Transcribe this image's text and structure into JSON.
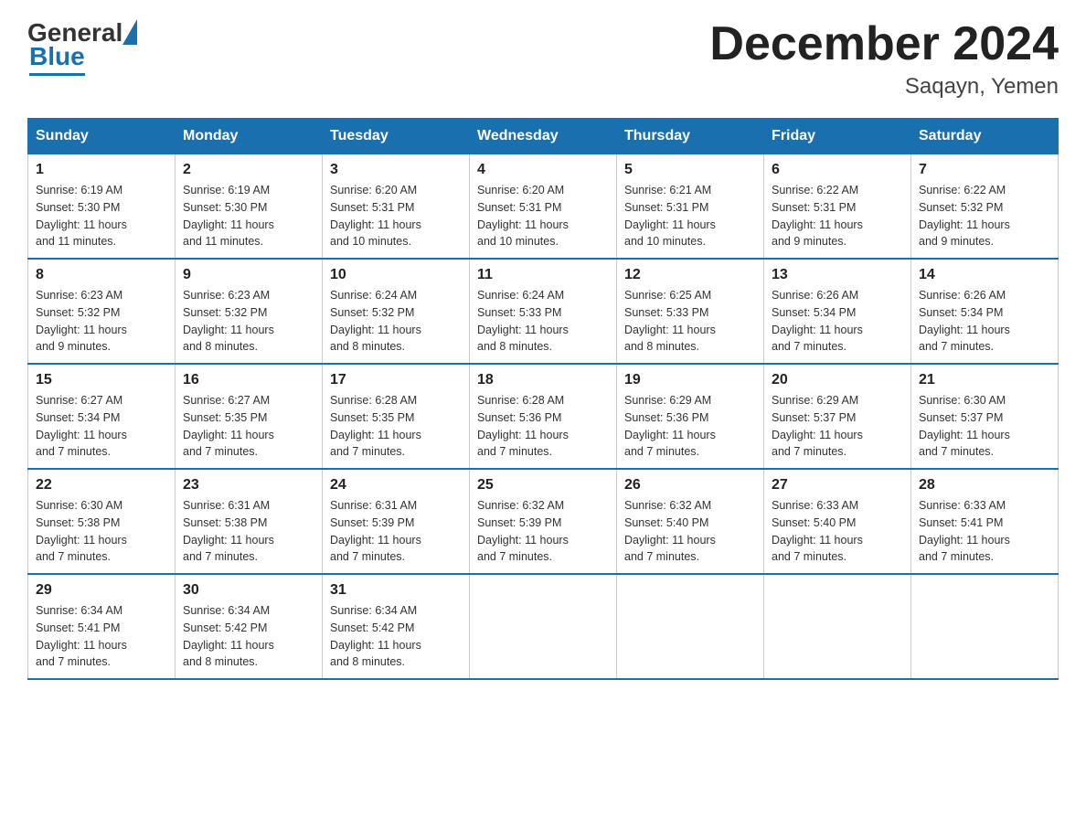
{
  "header": {
    "logo_general": "General",
    "logo_blue": "Blue",
    "title": "December 2024",
    "subtitle": "Saqayn, Yemen"
  },
  "columns": [
    "Sunday",
    "Monday",
    "Tuesday",
    "Wednesday",
    "Thursday",
    "Friday",
    "Saturday"
  ],
  "weeks": [
    [
      {
        "day": "1",
        "sunrise": "6:19 AM",
        "sunset": "5:30 PM",
        "daylight": "11 hours and 11 minutes."
      },
      {
        "day": "2",
        "sunrise": "6:19 AM",
        "sunset": "5:30 PM",
        "daylight": "11 hours and 11 minutes."
      },
      {
        "day": "3",
        "sunrise": "6:20 AM",
        "sunset": "5:31 PM",
        "daylight": "11 hours and 10 minutes."
      },
      {
        "day": "4",
        "sunrise": "6:20 AM",
        "sunset": "5:31 PM",
        "daylight": "11 hours and 10 minutes."
      },
      {
        "day": "5",
        "sunrise": "6:21 AM",
        "sunset": "5:31 PM",
        "daylight": "11 hours and 10 minutes."
      },
      {
        "day": "6",
        "sunrise": "6:22 AM",
        "sunset": "5:31 PM",
        "daylight": "11 hours and 9 minutes."
      },
      {
        "day": "7",
        "sunrise": "6:22 AM",
        "sunset": "5:32 PM",
        "daylight": "11 hours and 9 minutes."
      }
    ],
    [
      {
        "day": "8",
        "sunrise": "6:23 AM",
        "sunset": "5:32 PM",
        "daylight": "11 hours and 9 minutes."
      },
      {
        "day": "9",
        "sunrise": "6:23 AM",
        "sunset": "5:32 PM",
        "daylight": "11 hours and 8 minutes."
      },
      {
        "day": "10",
        "sunrise": "6:24 AM",
        "sunset": "5:32 PM",
        "daylight": "11 hours and 8 minutes."
      },
      {
        "day": "11",
        "sunrise": "6:24 AM",
        "sunset": "5:33 PM",
        "daylight": "11 hours and 8 minutes."
      },
      {
        "day": "12",
        "sunrise": "6:25 AM",
        "sunset": "5:33 PM",
        "daylight": "11 hours and 8 minutes."
      },
      {
        "day": "13",
        "sunrise": "6:26 AM",
        "sunset": "5:34 PM",
        "daylight": "11 hours and 7 minutes."
      },
      {
        "day": "14",
        "sunrise": "6:26 AM",
        "sunset": "5:34 PM",
        "daylight": "11 hours and 7 minutes."
      }
    ],
    [
      {
        "day": "15",
        "sunrise": "6:27 AM",
        "sunset": "5:34 PM",
        "daylight": "11 hours and 7 minutes."
      },
      {
        "day": "16",
        "sunrise": "6:27 AM",
        "sunset": "5:35 PM",
        "daylight": "11 hours and 7 minutes."
      },
      {
        "day": "17",
        "sunrise": "6:28 AM",
        "sunset": "5:35 PM",
        "daylight": "11 hours and 7 minutes."
      },
      {
        "day": "18",
        "sunrise": "6:28 AM",
        "sunset": "5:36 PM",
        "daylight": "11 hours and 7 minutes."
      },
      {
        "day": "19",
        "sunrise": "6:29 AM",
        "sunset": "5:36 PM",
        "daylight": "11 hours and 7 minutes."
      },
      {
        "day": "20",
        "sunrise": "6:29 AM",
        "sunset": "5:37 PM",
        "daylight": "11 hours and 7 minutes."
      },
      {
        "day": "21",
        "sunrise": "6:30 AM",
        "sunset": "5:37 PM",
        "daylight": "11 hours and 7 minutes."
      }
    ],
    [
      {
        "day": "22",
        "sunrise": "6:30 AM",
        "sunset": "5:38 PM",
        "daylight": "11 hours and 7 minutes."
      },
      {
        "day": "23",
        "sunrise": "6:31 AM",
        "sunset": "5:38 PM",
        "daylight": "11 hours and 7 minutes."
      },
      {
        "day": "24",
        "sunrise": "6:31 AM",
        "sunset": "5:39 PM",
        "daylight": "11 hours and 7 minutes."
      },
      {
        "day": "25",
        "sunrise": "6:32 AM",
        "sunset": "5:39 PM",
        "daylight": "11 hours and 7 minutes."
      },
      {
        "day": "26",
        "sunrise": "6:32 AM",
        "sunset": "5:40 PM",
        "daylight": "11 hours and 7 minutes."
      },
      {
        "day": "27",
        "sunrise": "6:33 AM",
        "sunset": "5:40 PM",
        "daylight": "11 hours and 7 minutes."
      },
      {
        "day": "28",
        "sunrise": "6:33 AM",
        "sunset": "5:41 PM",
        "daylight": "11 hours and 7 minutes."
      }
    ],
    [
      {
        "day": "29",
        "sunrise": "6:34 AM",
        "sunset": "5:41 PM",
        "daylight": "11 hours and 7 minutes."
      },
      {
        "day": "30",
        "sunrise": "6:34 AM",
        "sunset": "5:42 PM",
        "daylight": "11 hours and 8 minutes."
      },
      {
        "day": "31",
        "sunrise": "6:34 AM",
        "sunset": "5:42 PM",
        "daylight": "11 hours and 8 minutes."
      },
      null,
      null,
      null,
      null
    ]
  ],
  "labels": {
    "sunrise": "Sunrise:",
    "sunset": "Sunset:",
    "daylight": "Daylight:"
  }
}
